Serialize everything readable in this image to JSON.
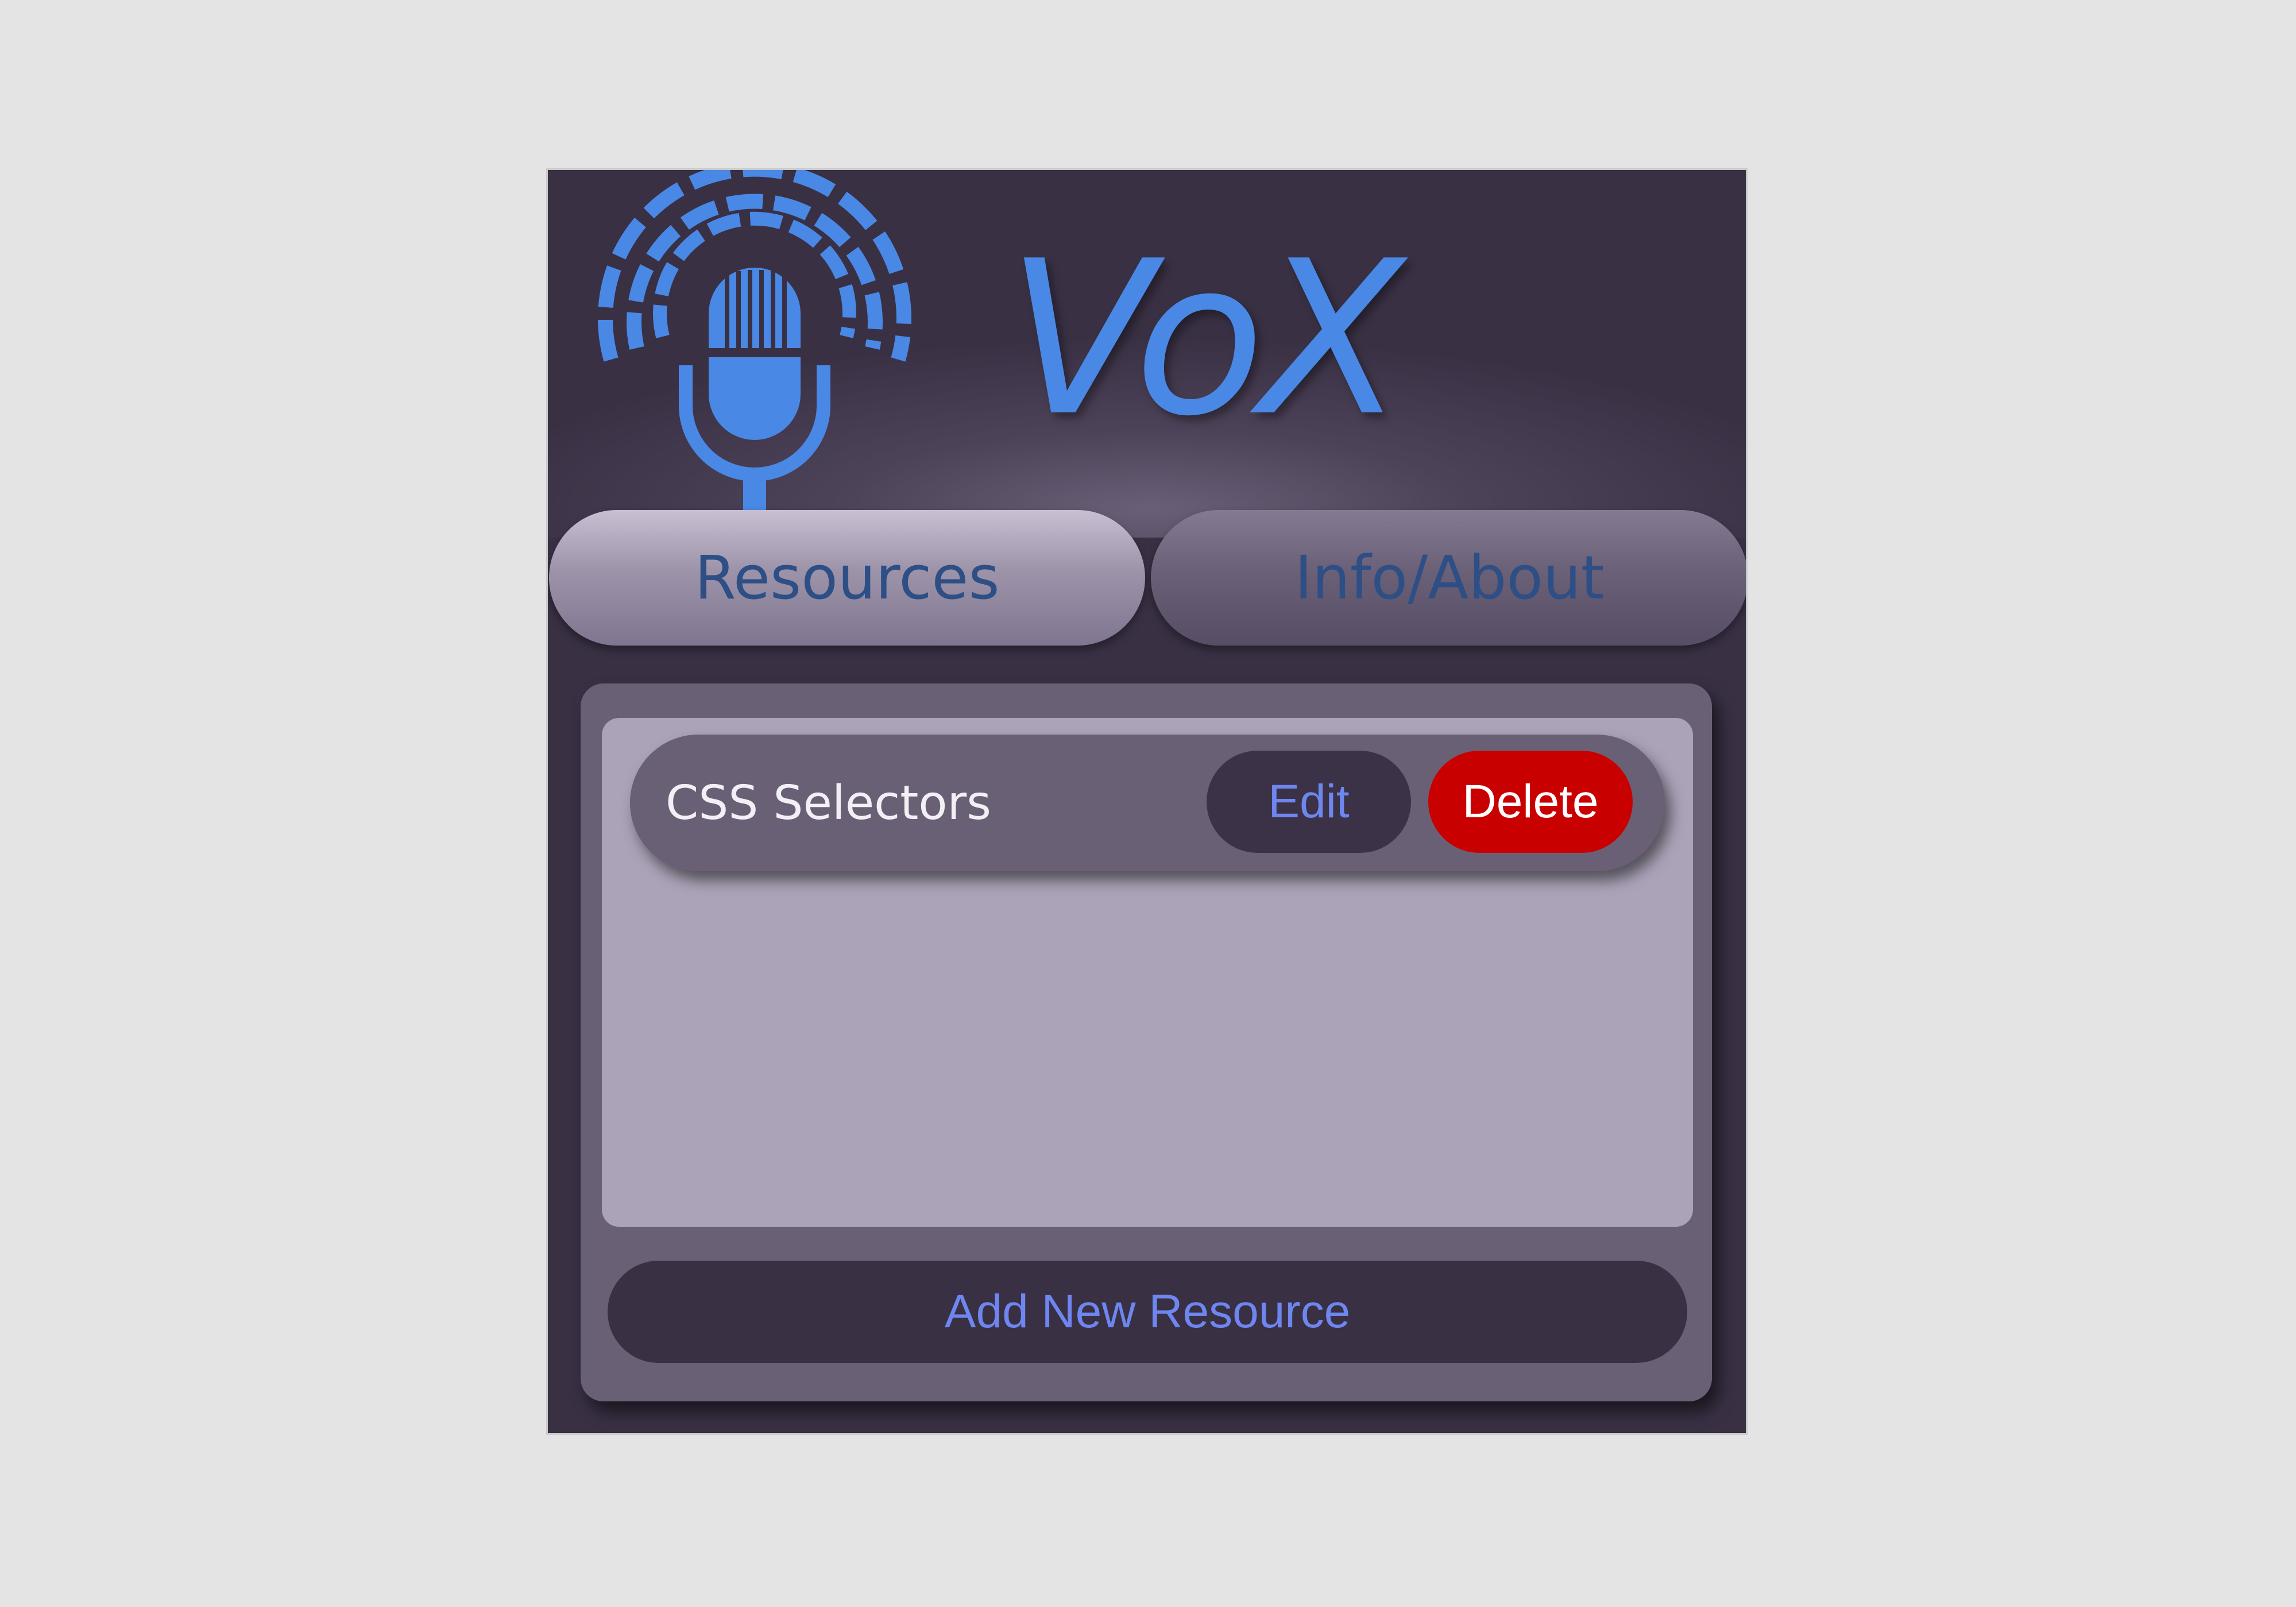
{
  "header": {
    "brand": "VoX",
    "logo_icon": "microphone-broadcast-icon"
  },
  "tabs": [
    {
      "label": "Resources",
      "active": true
    },
    {
      "label": "Info/About",
      "active": false
    }
  ],
  "resources": [
    {
      "name": "CSS Selectors",
      "edit_label": "Edit",
      "delete_label": "Delete"
    }
  ],
  "actions": {
    "add_label": "Add New Resource"
  },
  "colors": {
    "accent": "#4a88e6",
    "delete": "#c90000",
    "background": "#393044"
  }
}
